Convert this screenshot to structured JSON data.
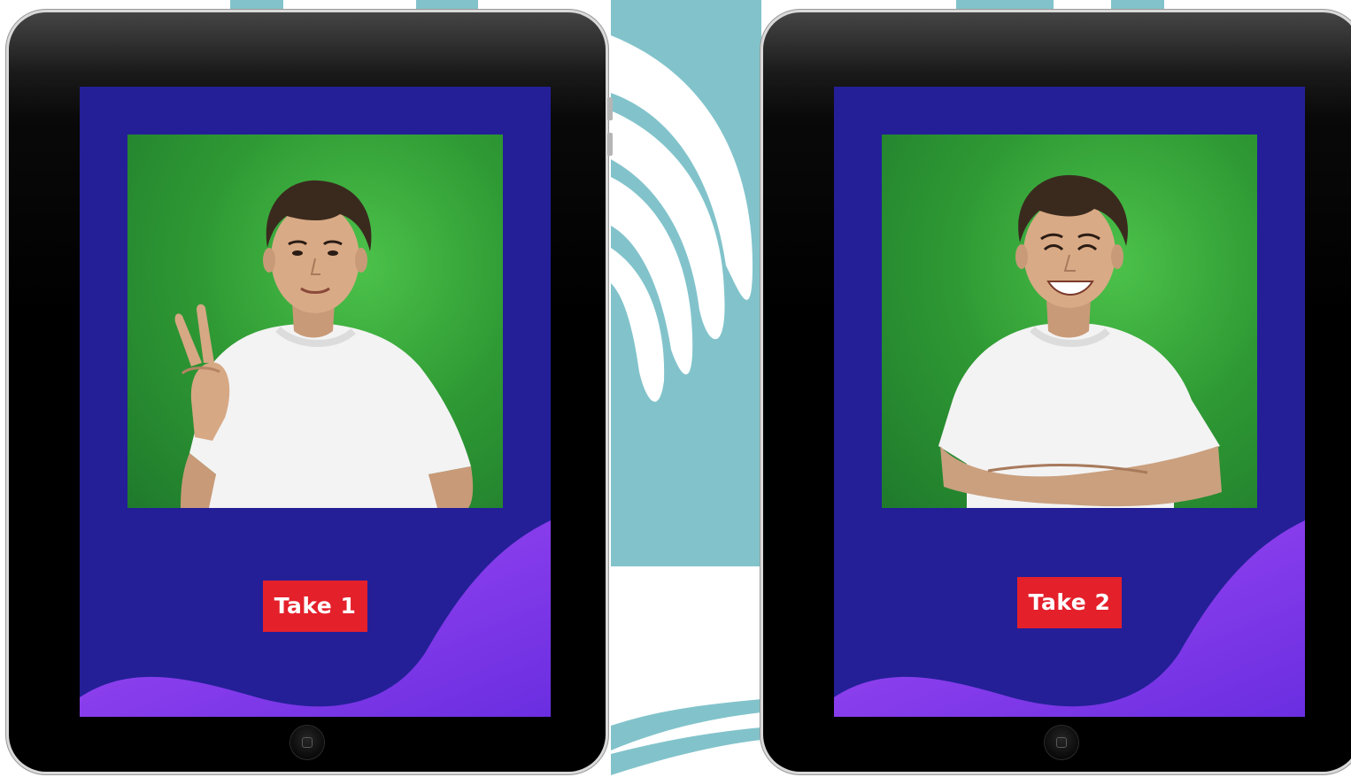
{
  "scene": {
    "background_color": "#ffffff",
    "swirl_color": "#7fc1c9"
  },
  "tablets": [
    {
      "take_label": "Take 1",
      "pose": "peace-sign",
      "expression": "smile",
      "screen_color": "#241f97",
      "wave_color": "#8a3cf0",
      "backdrop_color": "#3aa53c",
      "label_color": "#e4202b"
    },
    {
      "take_label": "Take 2",
      "pose": "arms-crossed",
      "expression": "grin",
      "screen_color": "#241f97",
      "wave_color": "#8a3cf0",
      "backdrop_color": "#3aa53c",
      "label_color": "#e4202b"
    }
  ],
  "icons": {
    "home_button": "home-button-icon"
  }
}
